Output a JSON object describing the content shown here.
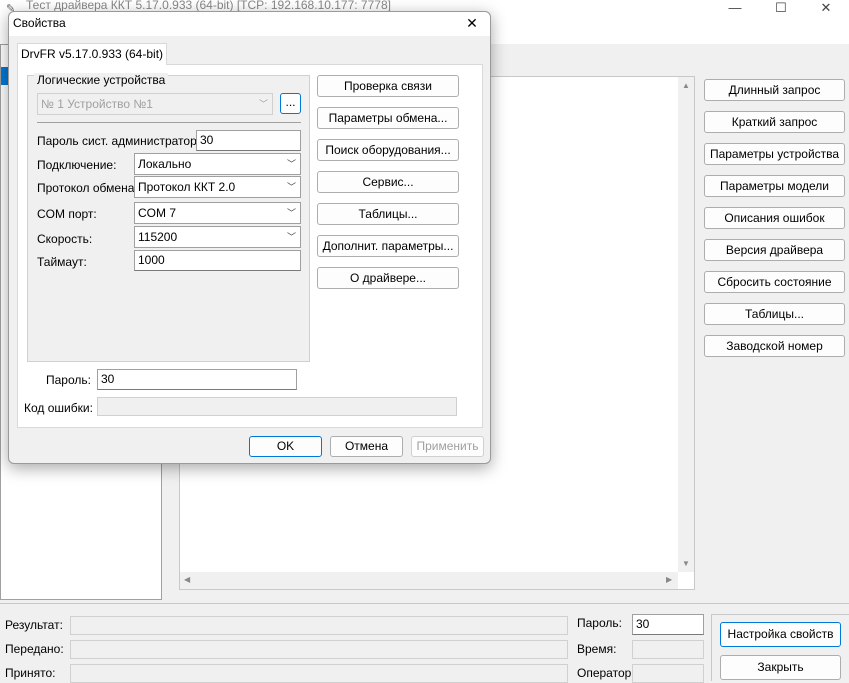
{
  "main_window": {
    "title": "Тест драйвера ККТ 5.17.0.933 (64-bit) [TCP: 192.168.10.177: 7778]",
    "controls": {
      "minimize": "—",
      "maximize": "☐",
      "close": "✕"
    },
    "right_buttons": [
      "Длинный запрос",
      "Краткий запрос",
      "Параметры устройства",
      "Параметры модели",
      "Описания ошибок",
      "Версия драйвера",
      "Сбросить состояние",
      "Таблицы...",
      "Заводской номер"
    ],
    "status": {
      "result_label": "Результат:",
      "sent_label": "Передано:",
      "received_label": "Принято:",
      "password_label": "Пароль:",
      "password_value": "30",
      "time_label": "Время:",
      "operator_label": "Оператор:"
    },
    "settings_button": "Настройка свойств",
    "close_button": "Закрыть"
  },
  "dialog": {
    "title": "Свойства",
    "close_glyph": "✕",
    "tab_label": "DrvFR v5.17.0.933 (64-bit)",
    "group_label": "Логические устройства",
    "device_value": "№ 1 Устройство №1",
    "device_browse": "...",
    "admin_password_label": "Пароль сист. администратора:",
    "admin_password_value": "30",
    "connection_label": "Подключение:",
    "connection_value": "Локально",
    "protocol_label": "Протокол обмена:",
    "protocol_value": "Протокол ККТ 2.0",
    "com_port_label": "COM порт:",
    "com_port_value": "COM 7",
    "speed_label": "Скорость:",
    "speed_value": "115200",
    "timeout_label": "Таймаут:",
    "timeout_value": "1000",
    "password_label": "Пароль:",
    "password_value": "30",
    "error_code_label": "Код ошибки:",
    "action_buttons": [
      "Проверка связи",
      "Параметры обмена...",
      "Поиск оборудования...",
      "Сервис...",
      "Таблицы...",
      "Дополнит. параметры...",
      "О драйвере..."
    ],
    "ok": "OK",
    "cancel": "Отмена",
    "apply": "Применить"
  },
  "colors": {
    "accent": "#0078d7",
    "ok_border": "#0078d7",
    "disabled_text": "#a0a0a0"
  },
  "icons": [
    "app-icon",
    "chevron-down-icon",
    "scroll-up-icon",
    "scroll-down-icon",
    "scroll-left-icon",
    "scroll-right-icon",
    "close-icon"
  ]
}
